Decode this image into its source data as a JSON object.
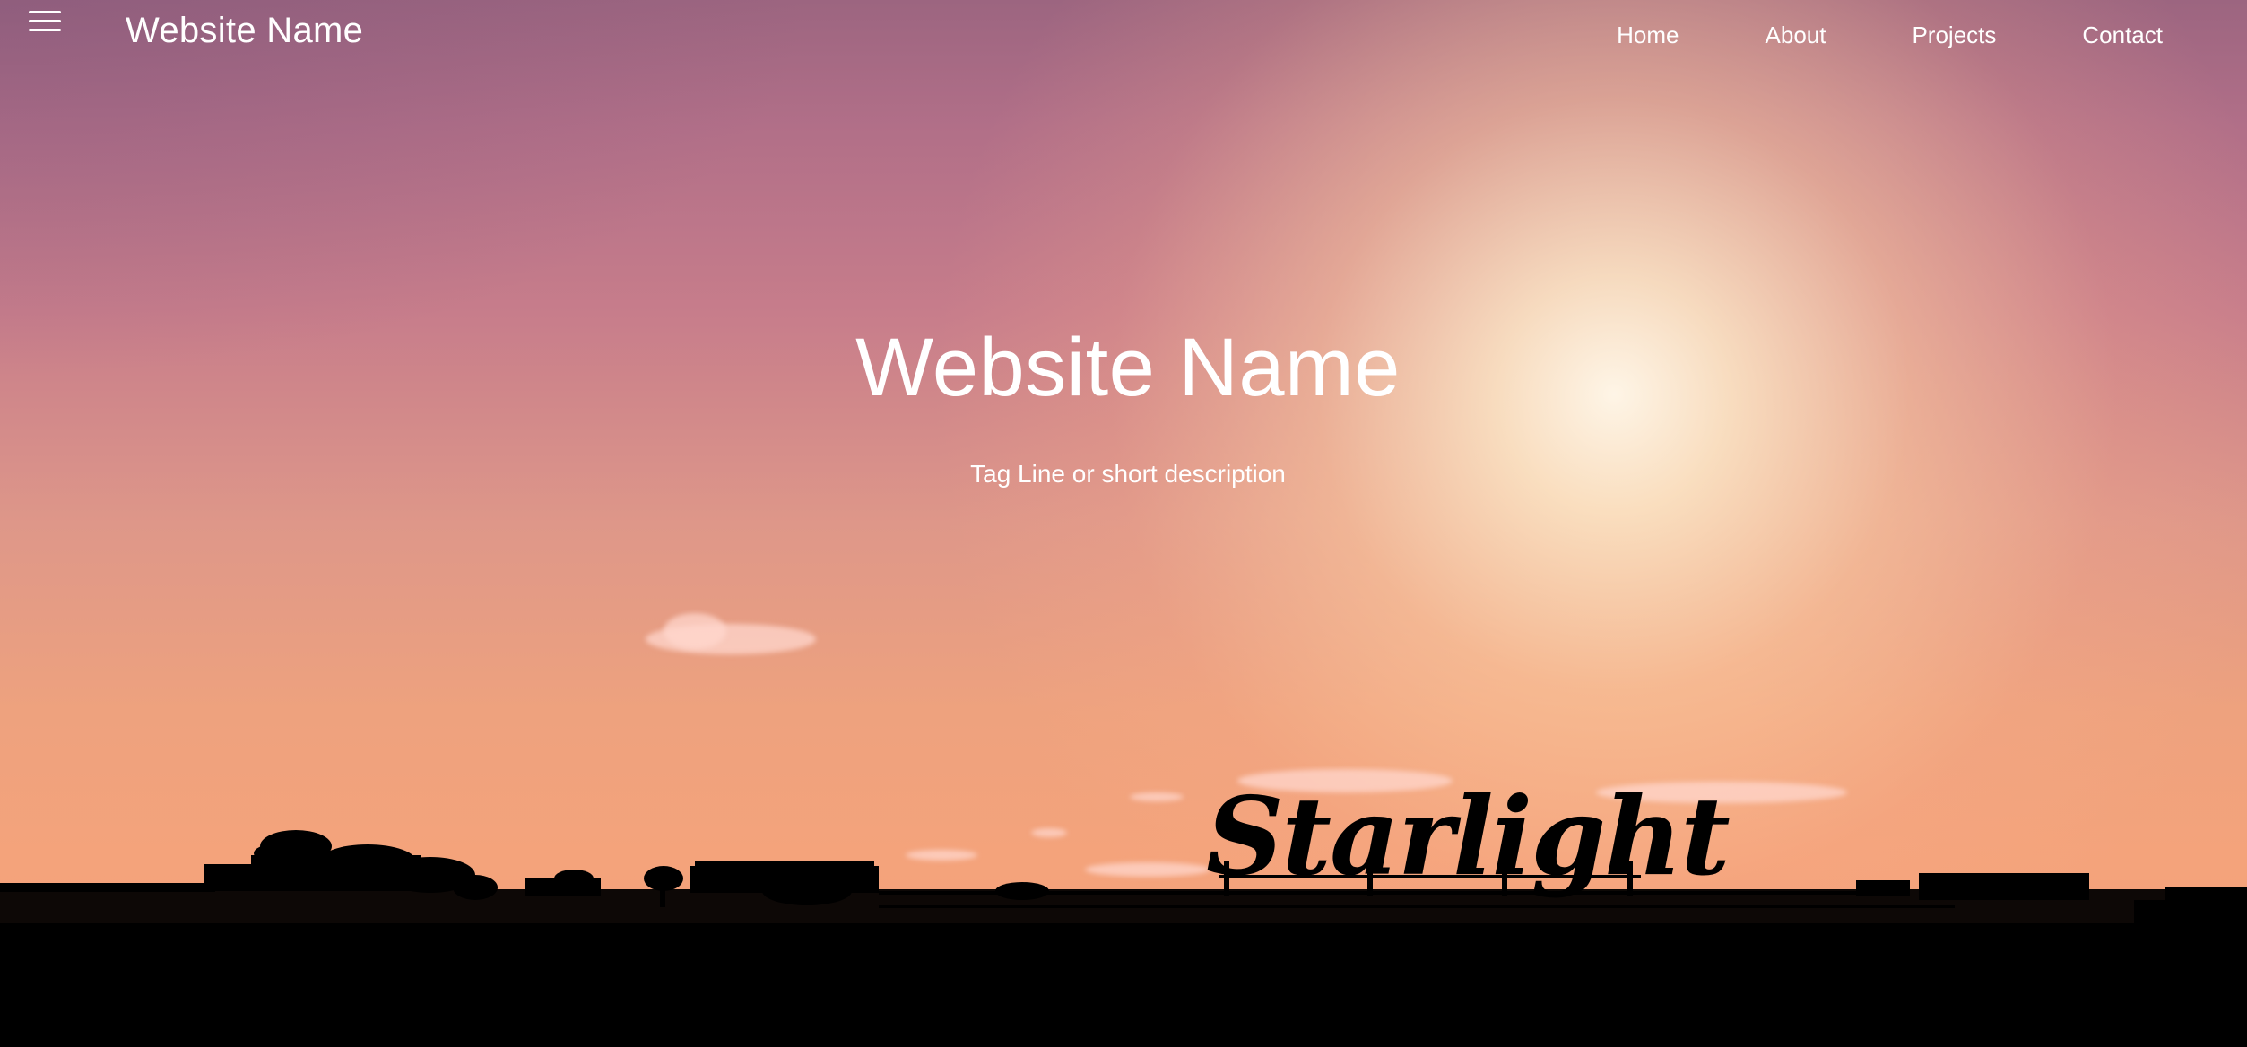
{
  "nav": {
    "brand": "Website Name",
    "links": [
      "Home",
      "About",
      "Projects",
      "Contact"
    ]
  },
  "hero": {
    "title": "Website Name",
    "tagline": "Tag Line or short description",
    "sign_text": "Starlight"
  },
  "colors": {
    "sky_top": "#9c6580",
    "sky_mid": "#de9789",
    "sky_bottom": "#f4a37b",
    "sun": "#fff7e8",
    "silhouette": "#000000",
    "text": "#ffffff"
  },
  "icons": {
    "menu": "hamburger-menu-icon"
  }
}
